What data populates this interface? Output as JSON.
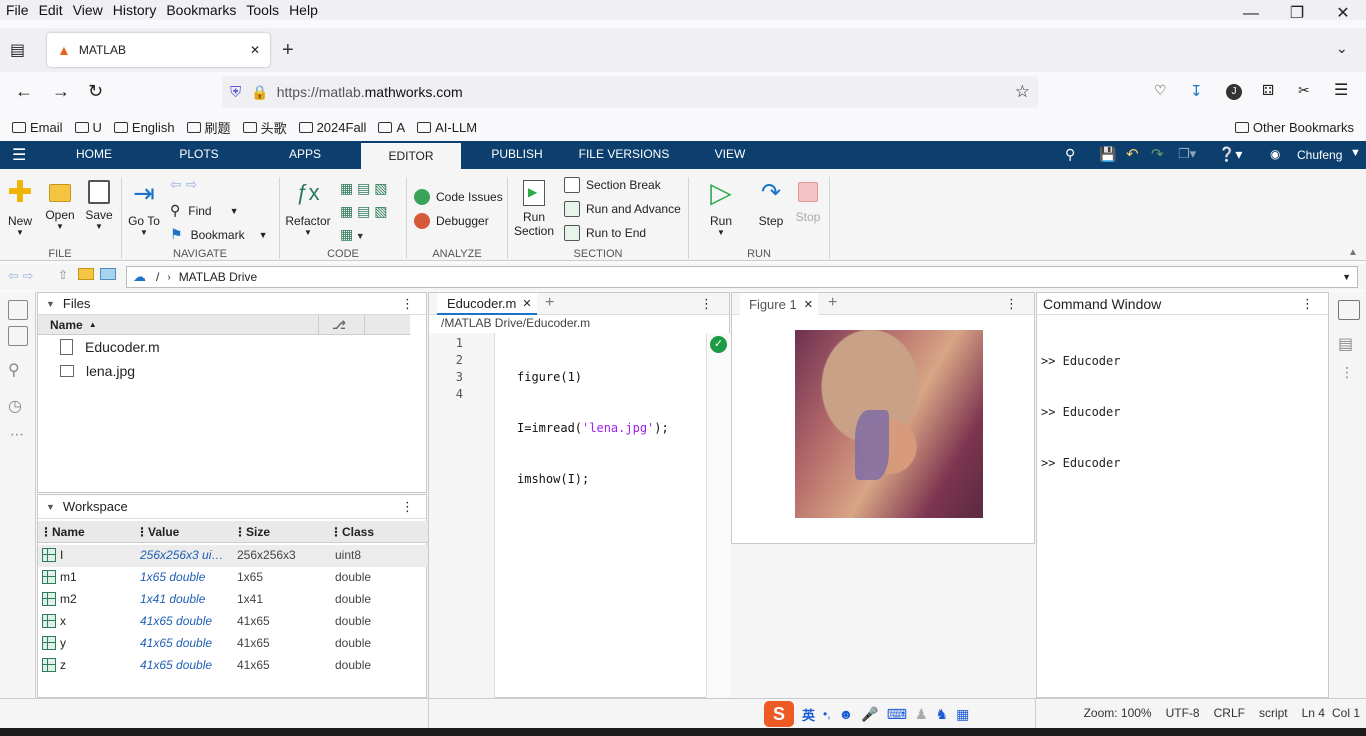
{
  "browser": {
    "menu": [
      "File",
      "Edit",
      "View",
      "History",
      "Bookmarks",
      "Tools",
      "Help"
    ],
    "tab_title": "MATLAB",
    "url_prefix": "https://matlab.",
    "url_domain": "mathworks.com",
    "bookmarks": [
      "Email",
      "U",
      "English",
      "刷题",
      "头歌",
      "2024Fall",
      "A",
      "AI-LLM"
    ],
    "other_bookmarks": "Other Bookmarks"
  },
  "toolstrip": {
    "tabs": [
      "HOME",
      "PLOTS",
      "APPS",
      "EDITOR",
      "PUBLISH",
      "FILE VERSIONS",
      "VIEW"
    ],
    "user": "Chufeng",
    "file": {
      "new": "New",
      "open": "Open",
      "save": "Save",
      "label": "FILE"
    },
    "navigate": {
      "goto": "Go To",
      "find": "Find",
      "bookmark": "Bookmark",
      "label": "NAVIGATE"
    },
    "code": {
      "refactor": "Refactor",
      "label": "CODE"
    },
    "analyze": {
      "code_issues": "Code Issues",
      "debugger": "Debugger",
      "label": "ANALYZE"
    },
    "section": {
      "run_section_1": "Run",
      "run_section_2": "Section",
      "section_break": "Section Break",
      "run_advance": "Run and Advance",
      "run_to_end": "Run to End",
      "label": "SECTION"
    },
    "run": {
      "run": "Run",
      "step": "Step",
      "stop": "Stop",
      "label": "RUN"
    }
  },
  "address": {
    "root": "/",
    "folder": "MATLAB Drive"
  },
  "files": {
    "title": "Files",
    "col_name": "Name",
    "items": [
      "Educoder.m",
      "lena.jpg"
    ]
  },
  "workspace": {
    "title": "Workspace",
    "cols": [
      "Name",
      "Value",
      "Size",
      "Class"
    ],
    "rows": [
      {
        "name": "I",
        "value": "256x256x3 ui…",
        "size": "256x256x3",
        "class": "uint8"
      },
      {
        "name": "m1",
        "value": "1x65 double",
        "size": "1x65",
        "class": "double"
      },
      {
        "name": "m2",
        "value": "1x41 double",
        "size": "1x41",
        "class": "double"
      },
      {
        "name": "x",
        "value": "41x65 double",
        "size": "41x65",
        "class": "double"
      },
      {
        "name": "y",
        "value": "41x65 double",
        "size": "41x65",
        "class": "double"
      },
      {
        "name": "z",
        "value": "41x65 double",
        "size": "41x65",
        "class": "double"
      }
    ]
  },
  "editor": {
    "tab": "Educoder.m",
    "path": "/MATLAB Drive/Educoder.m",
    "lines": [
      {
        "n": "1",
        "pre": "figure(1)",
        "str": "",
        "post": ""
      },
      {
        "n": "2",
        "pre": "I=imread(",
        "str": "'lena.jpg'",
        "post": ");"
      },
      {
        "n": "3",
        "pre": "imshow(I);",
        "str": "",
        "post": ""
      },
      {
        "n": "4",
        "pre": "",
        "str": "",
        "post": ""
      }
    ]
  },
  "figure": {
    "tab": "Figure 1"
  },
  "command": {
    "title": "Command Window",
    "lines": [
      ">> Educoder",
      ">> Educoder",
      ">> Educoder"
    ]
  },
  "status": {
    "zoom": "Zoom: 100%",
    "encoding": "UTF-8",
    "eol": "CRLF",
    "type": "script",
    "ln": "Ln  4",
    "col": "Col  1"
  },
  "ime": {
    "lang": "英"
  },
  "colors": {
    "toolstrip_bg": "#0d3f6e",
    "run_green": "#2aa84a",
    "string_purple": "#a020f0",
    "value_blue": "#1f5fb5"
  }
}
